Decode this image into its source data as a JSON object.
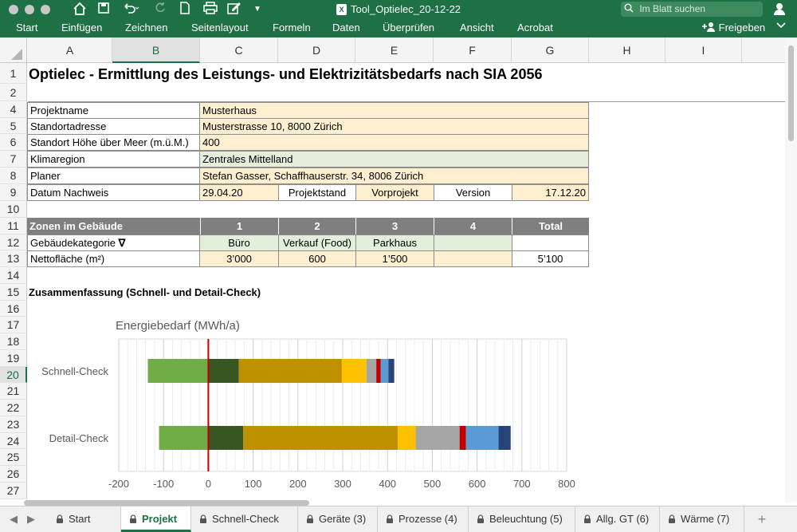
{
  "window": {
    "title": "Tool_Optielec_20-12-22",
    "search_placeholder": "Im Blatt suchen",
    "doc_badge": "X"
  },
  "ribbon": {
    "tabs": [
      "Start",
      "Einfügen",
      "Zeichnen",
      "Seitenlayout",
      "Formeln",
      "Daten",
      "Überprüfen",
      "Ansicht",
      "Acrobat"
    ],
    "share": "Freigeben"
  },
  "columns": [
    "A",
    "B",
    "C",
    "D",
    "E",
    "F",
    "G",
    "H",
    "I"
  ],
  "rows": [
    "1",
    "2",
    "4",
    "5",
    "6",
    "7",
    "8",
    "9",
    "10",
    "11",
    "12",
    "13",
    "14",
    "15",
    "16",
    "17",
    "18",
    "19",
    "20",
    "21",
    "22",
    "23",
    "24",
    "25",
    "26",
    "27"
  ],
  "selected_column": "B",
  "selected_row": "20",
  "sheet": {
    "title": "Optielec - Ermittlung des Leistungs- und Elektrizitätsbedarfs nach SIA 2056",
    "project": {
      "name_label": "Projektname",
      "name_value": "Musterhaus",
      "address_label": "Standortadresse",
      "address_value": "Musterstrasse 10, 8000 Zürich",
      "height_label": "Standort Höhe über Meer (m.ü.M.)",
      "height_value": "400",
      "climate_label": "Klimaregion",
      "climate_value": "Zentrales Mittelland",
      "planner_label": "Planer",
      "planner_value": "Stefan Gasser, Schaffhauserstr. 34, 8006 Zürich",
      "date_label": "Datum Nachweis",
      "date_value": "29.04.20",
      "stage_label": "Projektstand",
      "stage_value": "Vorprojekt",
      "version_label": "Version",
      "version_value": "17.12.20"
    },
    "zones": {
      "header_label": "Zonen im Gebäude",
      "headers": [
        "1",
        "2",
        "3",
        "4",
        "Total"
      ],
      "category_label": "Gebäudekategorie",
      "filter_glyph": "∇",
      "categories": [
        "Büro",
        "Verkauf (Food)",
        "Parkhaus",
        "",
        ""
      ],
      "area_label": "Nettofläche (m²)",
      "areas": [
        "3’000",
        "600",
        "1’500",
        "",
        "5’100"
      ]
    },
    "summary_title": "Zusammenfassung (Schnell- und Detail-Check)"
  },
  "chart_data": {
    "type": "bar",
    "orientation": "horizontal",
    "stacked": true,
    "title": "Energiebedarf (MWh/a)",
    "categories": [
      "Schnell-Check",
      "Detail-Check"
    ],
    "xlim": [
      -200,
      800
    ],
    "xticks": [
      "-200",
      "-100",
      "0",
      "100",
      "200",
      "300",
      "400",
      "500",
      "600",
      "700",
      "800"
    ],
    "grid": true,
    "zero_line_color": "#c00000",
    "negative": {
      "color": "#70ad47",
      "values": [
        -135,
        -110
      ]
    },
    "series": [
      {
        "color": "#375623",
        "values": [
          68,
          78
        ]
      },
      {
        "color": "#bf9000",
        "values": [
          230,
          345
        ]
      },
      {
        "color": "#ffc000",
        "values": [
          55,
          40
        ]
      },
      {
        "color": "#a5a5a5",
        "values": [
          22,
          98
        ]
      },
      {
        "color": "#c00000",
        "values": [
          10,
          14
        ]
      },
      {
        "color": "#5b9bd5",
        "values": [
          17,
          73
        ]
      },
      {
        "color": "#264478",
        "values": [
          13,
          27
        ]
      }
    ]
  },
  "sheet_tabs": [
    "Start",
    "Projekt",
    "Schnell-Check",
    "Geräte (3)",
    "Prozesse (4)",
    "Beleuchtung (5)",
    "Allg. GT (6)",
    "Wärme (7)"
  ],
  "active_tab": "Projekt",
  "add_tab": "+"
}
